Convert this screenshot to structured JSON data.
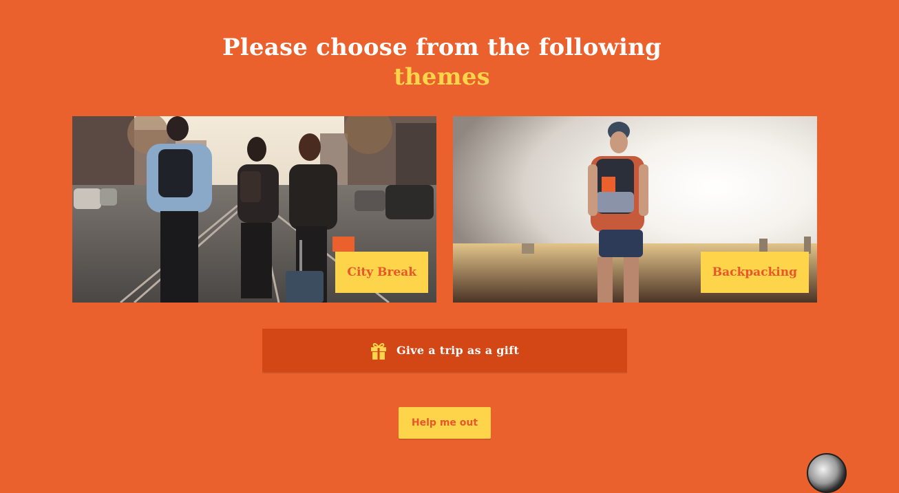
{
  "heading": {
    "line1": "Please choose from the following",
    "line2": "themes"
  },
  "themes": [
    {
      "label": "City Break"
    },
    {
      "label": "Backpacking"
    }
  ],
  "gift_button": {
    "label": "Give a trip as a gift",
    "icon": "gift-icon"
  },
  "help_button": {
    "label": "Help me out"
  },
  "colors": {
    "background": "#EA612E",
    "accent_yellow": "#FDD44A",
    "gift_button_bg": "#D34717",
    "label_text": "#E8562A"
  }
}
